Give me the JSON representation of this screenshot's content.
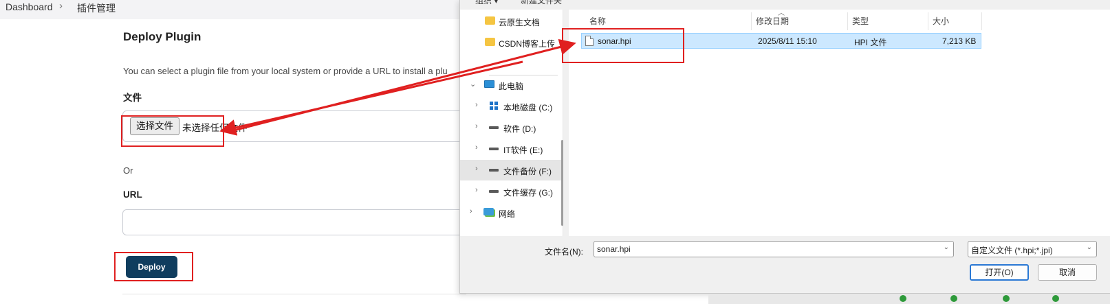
{
  "breadcrumb": {
    "home": "Dashboard",
    "current": "插件管理"
  },
  "deploy_section": {
    "title": "Deploy Plugin",
    "description": "You can select a plugin file from your local system or provide a URL to install a plu",
    "file_label": "文件",
    "choose_button": "选择文件",
    "no_file_text": "未选择任何文件",
    "or_text": "Or",
    "url_label": "URL",
    "url_value": "",
    "deploy_button": "Deploy"
  },
  "dialog": {
    "toolbar": {
      "organize": "组织 ▾",
      "new_folder": "新建文件夹"
    },
    "nav": {
      "quick": [
        "云原生文档",
        "CSDN博客上传"
      ],
      "this_pc": "此电脑",
      "drives": [
        "本地磁盘 (C:)",
        "软件 (D:)",
        "IT软件 (E:)",
        "文件备份 (F:)",
        "文件缓存 (G:)"
      ],
      "network": "网络"
    },
    "columns": {
      "name": "名称",
      "modified": "修改日期",
      "type": "类型",
      "size": "大小"
    },
    "files": [
      {
        "name": "sonar.hpi",
        "modified": "2025/8/11 15:10",
        "type": "HPI 文件",
        "size": "7,213 KB"
      }
    ],
    "filename_label": "文件名(N):",
    "filename_value": "sonar.hpi",
    "filter_value": "自定义文件 (*.hpi;*.jpi)",
    "open_button": "打开(O)",
    "cancel_button": "取消"
  },
  "colors": {
    "deploy_button_bg": "#0f3d5e",
    "annotation_red": "#e02020",
    "selection": "#cce8ff"
  }
}
